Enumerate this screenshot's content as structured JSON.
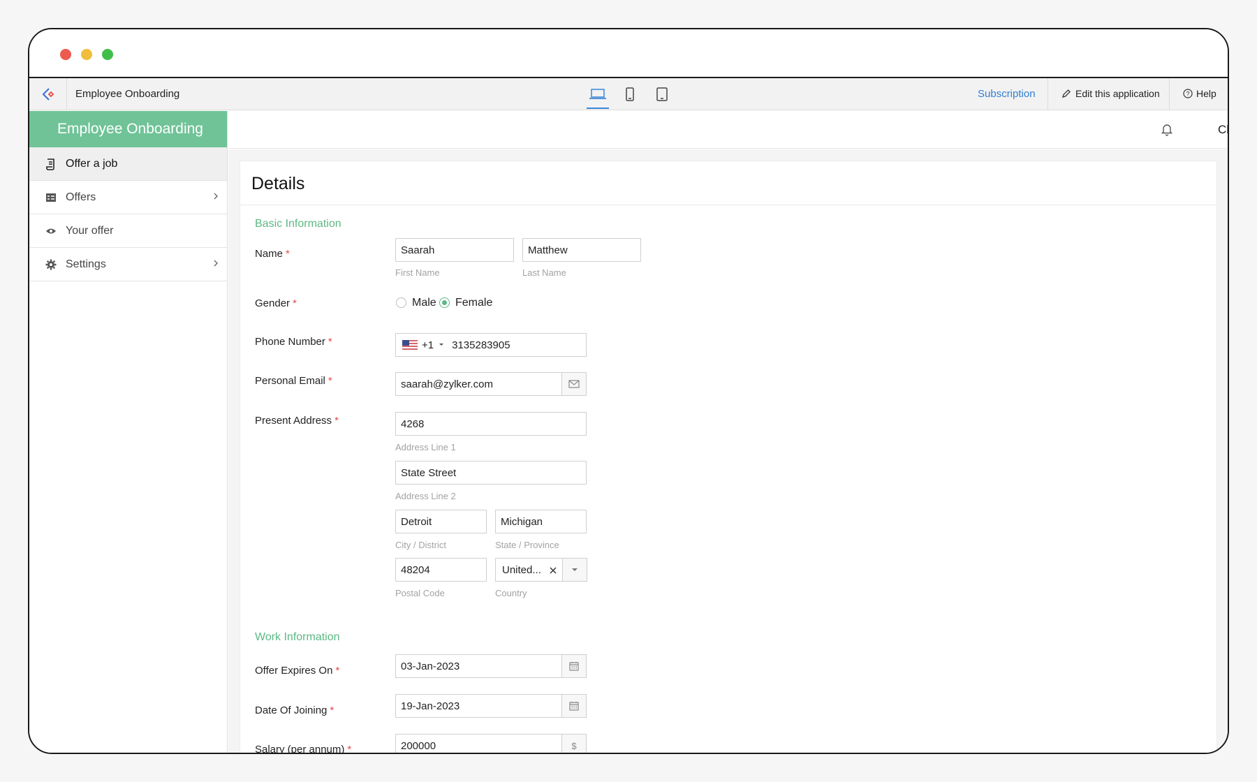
{
  "window": {
    "traffic_lights": [
      "close",
      "minimize",
      "maximize"
    ]
  },
  "appbar": {
    "app_name": "Employee Onboarding",
    "devices": [
      "laptop-icon",
      "phone-icon",
      "tablet-icon"
    ],
    "subscription": "Subscription",
    "edit_app": "Edit this application",
    "help": "Help"
  },
  "sidebar": {
    "header": "Employee Onboarding",
    "items": [
      {
        "label": "Offer a job",
        "icon": "scroll-icon",
        "active": true
      },
      {
        "label": "Offers",
        "icon": "list-icon",
        "has_children": true
      },
      {
        "label": "Your offer",
        "icon": "eye-icon"
      },
      {
        "label": "Settings",
        "icon": "gear-icon",
        "has_children": true
      }
    ]
  },
  "topbar": {
    "user": "Chris"
  },
  "form": {
    "title": "Details",
    "basic_section": "Basic Information",
    "name": {
      "label": "Name",
      "first": "Saarah",
      "first_sub": "First Name",
      "last": "Matthew",
      "last_sub": "Last Name"
    },
    "gender": {
      "label": "Gender",
      "options": [
        "Male",
        "Female"
      ],
      "selected": "Female"
    },
    "phone": {
      "label": "Phone Number",
      "code": "+1",
      "number": "3135283905"
    },
    "email": {
      "label": "Personal Email",
      "value": "saarah@zylker.com"
    },
    "address": {
      "label": "Present Address",
      "line1": "4268",
      "line1_sub": "Address Line 1",
      "line2": "State Street",
      "line2_sub": "Address Line 2",
      "city": "Detroit",
      "city_sub": "City / District",
      "state": "Michigan",
      "state_sub": "State / Province",
      "postal": "48204",
      "postal_sub": "Postal Code",
      "country": "United...",
      "country_sub": "Country"
    },
    "work_section": "Work Information",
    "offer_expires": {
      "label": "Offer Expires On",
      "value": "03-Jan-2023"
    },
    "joining": {
      "label": "Date Of Joining",
      "value": "19-Jan-2023"
    },
    "salary": {
      "label": "Salary (per annum)",
      "value": "200000"
    }
  },
  "colors": {
    "accent": "#6fc397",
    "section": "#5cb883",
    "link": "#2e7fd4",
    "required": "#e04b4b"
  }
}
